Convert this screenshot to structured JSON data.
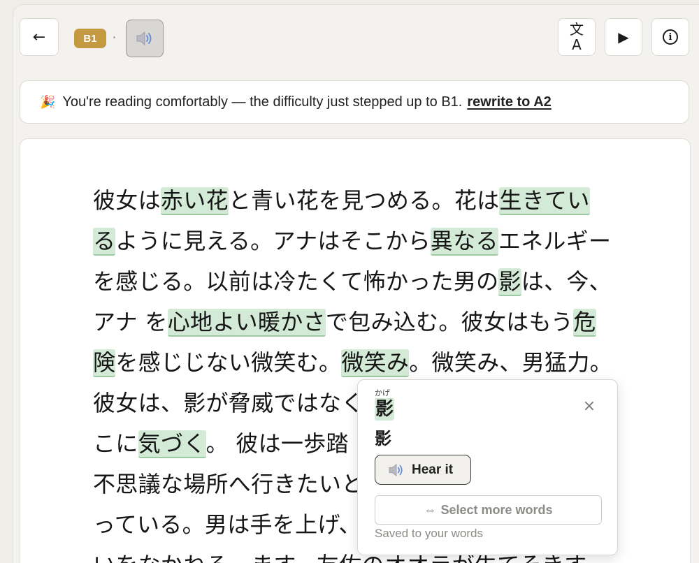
{
  "toolbar": {
    "back_icon": "←",
    "level": "B1",
    "separator": "·",
    "translate_top": "文",
    "translate_bottom": "A",
    "play_icon": "▶",
    "info_icon": "i"
  },
  "banner": {
    "emoji": "🎉",
    "message": "You're reading comfortably — the difficulty just stepped up to B1.",
    "action": "rewrite to A2"
  },
  "passage": {
    "lines": [
      [
        {
          "t": "彼女は"
        },
        {
          "t": "赤い花",
          "hl": true
        },
        {
          "t": "と青い花を見つめる。花は"
        },
        {
          "t": "生きてい",
          "hl": true
        }
      ],
      [
        {
          "t": "る",
          "hl": true
        },
        {
          "t": "ように見える。アナはそこから"
        },
        {
          "t": "異なる",
          "hl": true
        },
        {
          "t": "エネルギー"
        }
      ],
      [
        {
          "t": "を感じる。以前は冷たくて怖かった男の"
        },
        {
          "t": "影",
          "hl": true
        },
        {
          "t": "は、今、"
        }
      ],
      [
        {
          "t": "アナ を"
        },
        {
          "t": "心地よい暖かさ",
          "hl": true
        },
        {
          "t": "で包み込む。彼女はもう"
        },
        {
          "t": "危",
          "hl": true
        }
      ],
      [
        {
          "t": "険",
          "hl": true
        },
        {
          "t": "を感じじない微笑む。"
        },
        {
          "t": "微笑み",
          "hl": true
        },
        {
          "t": "。微笑み、男猛力。"
        }
      ],
      [
        {
          "t": "彼女は、影が脅威ではなく"
        }
      ],
      [
        {
          "t": "こに"
        },
        {
          "t": "気づく",
          "hl": true
        },
        {
          "t": "。 彼は一歩踏"
        }
      ],
      [
        {
          "t": "不思議な場所へ行きたいと"
        }
      ],
      [
        {
          "t": "っている。男は手を上げ、"
        }
      ],
      [
        {
          "t": "いをなかねる。ます。友佐のオオラが生てそきす"
        }
      ]
    ]
  },
  "popup": {
    "reading": "かげ",
    "word": "影",
    "subword": "影",
    "close_icon": "×",
    "hear_label": "Hear it",
    "select_label": "Select more words",
    "select_icon": "⇔",
    "saved_note": "Saved to your words"
  },
  "colors": {
    "highlight": "#d3ead6",
    "level_badge": "#c39a40",
    "background": "#eeede8"
  }
}
